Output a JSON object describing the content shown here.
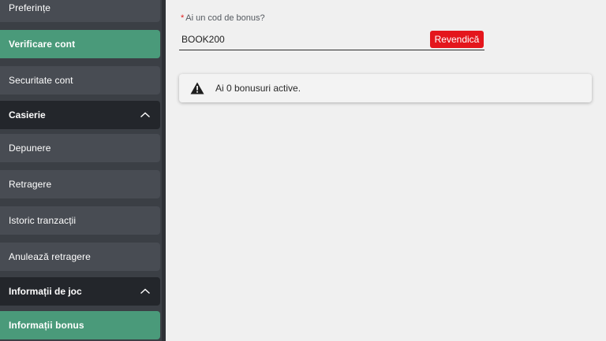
{
  "sidebar": {
    "items": [
      {
        "label": "Preferințe",
        "type": "item",
        "active": false
      },
      {
        "label": "Verificare cont",
        "type": "item",
        "active": true
      },
      {
        "label": "Securitate cont",
        "type": "item",
        "active": false
      },
      {
        "label": "Casierie",
        "type": "header",
        "icon": "chevron-up-icon"
      },
      {
        "label": "Depunere",
        "type": "item",
        "active": false
      },
      {
        "label": "Retragere",
        "type": "item",
        "active": false
      },
      {
        "label": "Istoric tranzacții",
        "type": "item",
        "active": false
      },
      {
        "label": "Anulează retragere",
        "type": "item",
        "active": false
      },
      {
        "label": "Informații de joc",
        "type": "header",
        "icon": "chevron-up-icon"
      },
      {
        "label": "Informații bonus",
        "type": "item",
        "active": true
      }
    ]
  },
  "bonus_form": {
    "required_mark": "*",
    "label": "Ai un cod de bonus?",
    "code_value": "BOOK200",
    "claim_label": "Revendică"
  },
  "alert": {
    "icon": "warning-icon",
    "message": "Ai 0 bonusuri active."
  },
  "colors": {
    "sidebar_bg": "#3b3f45",
    "item_bg": "#484c53",
    "header_bg": "#23262b",
    "active_bg": "#4a9a7a",
    "accent_red": "#e4161c",
    "main_bg": "#f0f0f0"
  }
}
